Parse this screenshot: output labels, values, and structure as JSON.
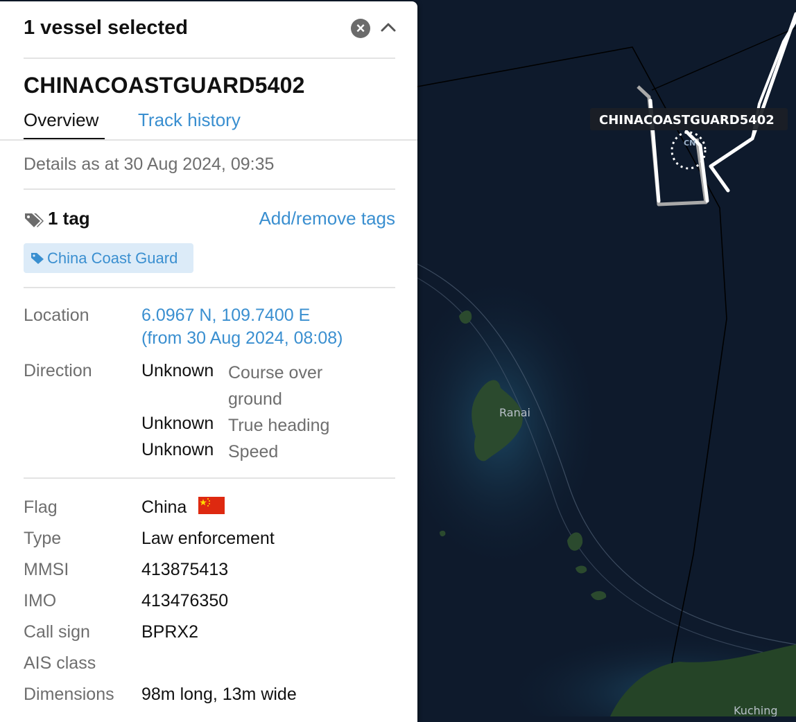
{
  "panel": {
    "header": "1 vessel selected",
    "close_glyph": "×",
    "vessel_name": "CHINACOASTGUARD5402",
    "tabs": [
      "Overview",
      "Track history"
    ],
    "details_as_at": "Details as at 30 Aug 2024, 09:35",
    "tags": {
      "count_label": "1 tag",
      "add_remove_label": "Add/remove tags",
      "items": [
        "China Coast Guard"
      ]
    },
    "location": {
      "label": "Location",
      "coords": "6.0967 N, 109.7400 E",
      "from": "(from 30 Aug 2024, 08:08)"
    },
    "direction": {
      "label": "Direction",
      "course_value": "Unknown",
      "course_label_1": "Course over",
      "course_label_2": "ground",
      "heading_value": "Unknown",
      "heading_label": "True heading",
      "speed_value": "Unknown",
      "speed_label": "Speed"
    },
    "details": {
      "flag_label": "Flag",
      "flag_value": "China",
      "type_label": "Type",
      "type_value": "Law enforcement",
      "mmsi_label": "MMSI",
      "mmsi_value": "413875413",
      "imo_label": "IMO",
      "imo_value": "413476350",
      "callsign_label": "Call sign",
      "callsign_value": "BPRX2",
      "ais_label": "AIS class",
      "ais_value": "",
      "dims_label": "Dimensions",
      "dims_value": "98m long, 13m wide"
    }
  },
  "map": {
    "vessel_label": "CHINACOASTGUARD5402",
    "vessel_marker": "CN",
    "island_label": "Ranai",
    "city_label": "Kuching",
    "colors": {
      "sea": "#0e1a2c",
      "track": "#ffffff",
      "label_bg": "#1b1f26"
    }
  },
  "icons": [
    "close-icon",
    "chevron-up-icon",
    "tags-icon",
    "tag-icon",
    "china-flag-icon"
  ]
}
